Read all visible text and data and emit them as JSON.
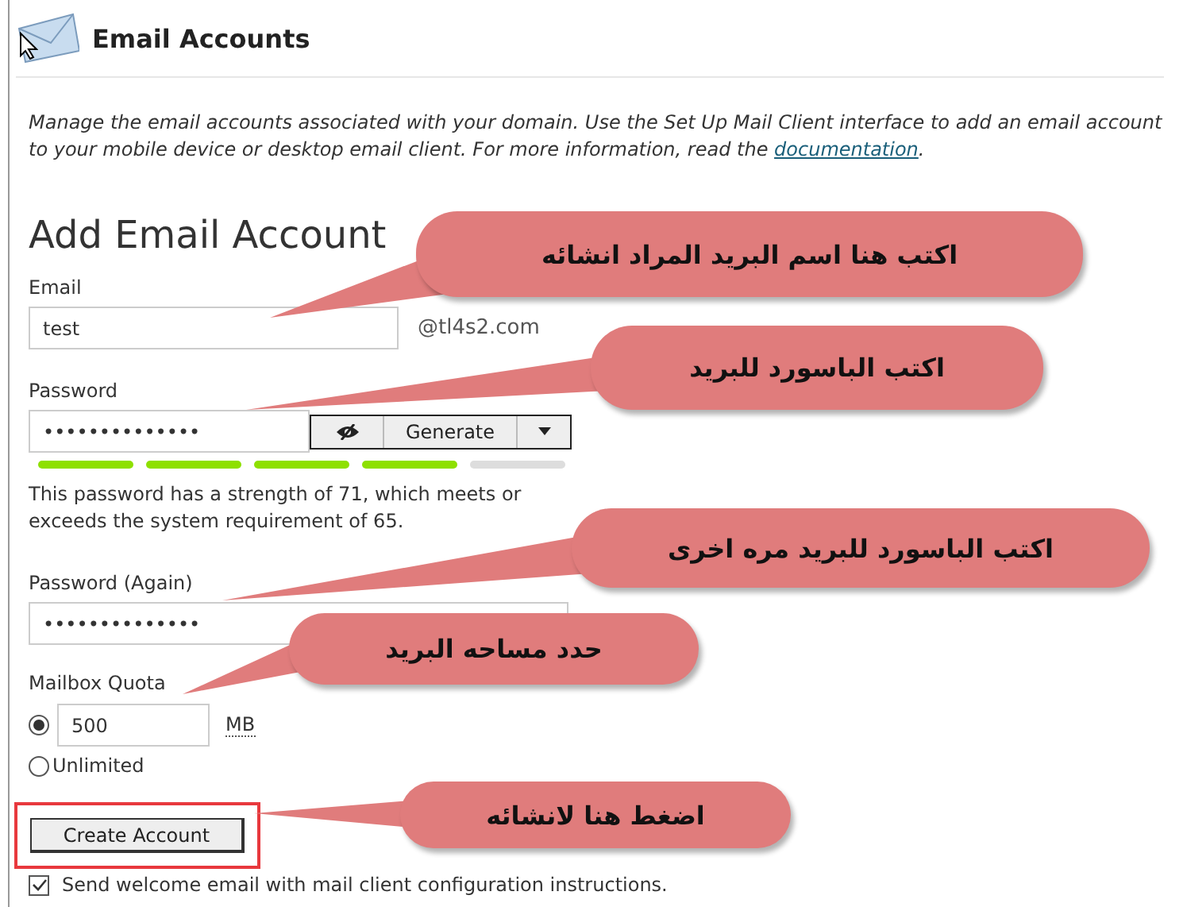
{
  "header": {
    "title": "Email Accounts"
  },
  "description": {
    "text": "Manage the email accounts associated with your domain. Use the Set Up Mail Client interface to add an email account to your mobile device or desktop email client. For more information, read the ",
    "link": "documentation",
    "end": "."
  },
  "form": {
    "heading": "Add Email Account",
    "email": {
      "label": "Email",
      "value": "test",
      "domain": "@tl4s2.com"
    },
    "password": {
      "label": "Password",
      "value": "••••••••••••••",
      "generate": "Generate"
    },
    "strength": {
      "segments": [
        {
          "filled": true
        },
        {
          "filled": true
        },
        {
          "filled": true
        },
        {
          "filled": true
        },
        {
          "filled": false
        }
      ],
      "message": "This password has a strength of 71, which meets or exceeds the system requirement of 65."
    },
    "password_again": {
      "label": "Password (Again)",
      "value": "••••••••••••••"
    },
    "quota": {
      "label": "Mailbox Quota",
      "options": [
        {
          "kind": "amount",
          "selected": true,
          "value": "500",
          "unit": "MB"
        },
        {
          "kind": "unlimited",
          "selected": false,
          "label": "Unlimited"
        }
      ]
    },
    "create_button": {
      "label": "Create Account",
      "highlighted": true
    },
    "welcome_email": {
      "label": "Send welcome email with mail client configuration instructions.",
      "checked": true
    }
  },
  "callouts": [
    {
      "text": "اكتب هنا اسم البريد المراد انشائه"
    },
    {
      "text": "اكتب الباسورد للبريد"
    },
    {
      "text": "اكتب الباسورد للبريد مره اخرى"
    },
    {
      "text": "حدد مساحه البريد"
    },
    {
      "text": "اضغط هنا لانشائه"
    }
  ]
}
